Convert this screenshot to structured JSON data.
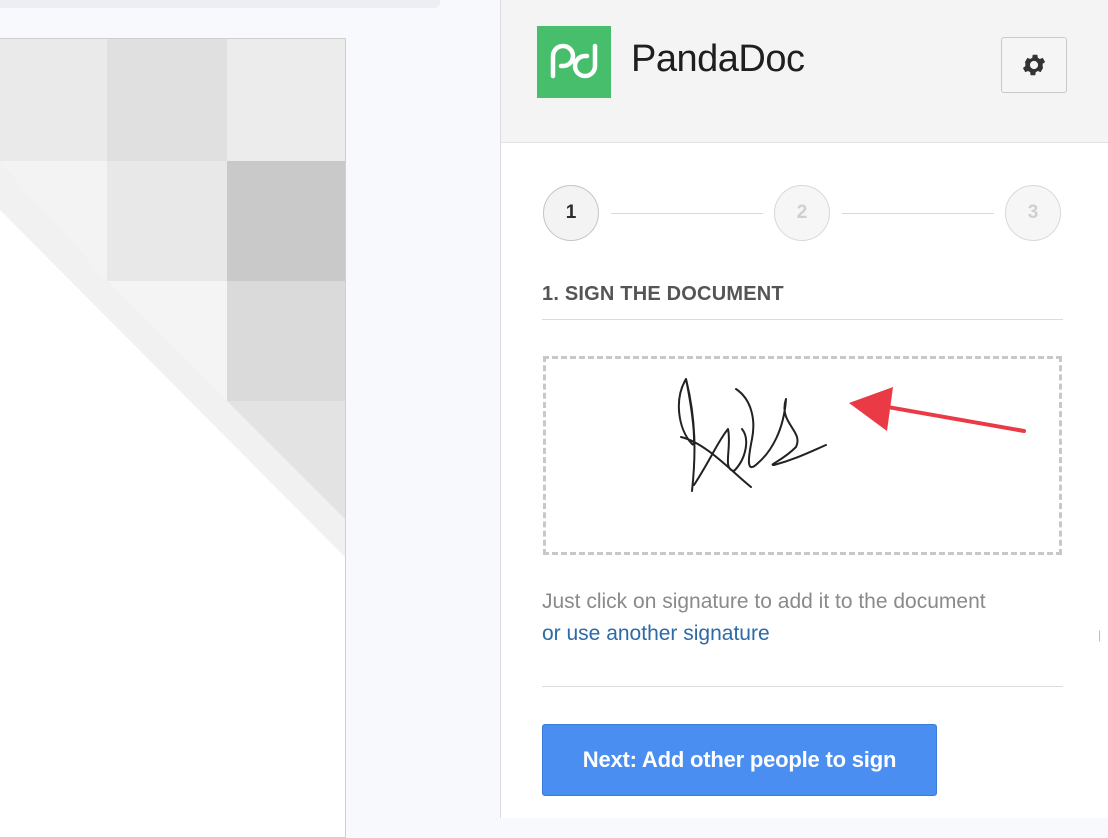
{
  "brand": {
    "name": "PandaDoc",
    "logo_icon": "pandadoc-logo-icon",
    "logo_color": "#47be6b"
  },
  "header": {
    "settings_icon": "gear-icon"
  },
  "stepper": {
    "steps": [
      "1",
      "2",
      "3"
    ],
    "active_step": "1"
  },
  "section": {
    "title": "1. SIGN THE DOCUMENT"
  },
  "signature": {
    "description_icon": "handwritten-signature",
    "annotation": "red-arrow-icon"
  },
  "hint": {
    "text": "Just click on signature to add it to the document",
    "link": "or use another signature"
  },
  "actions": {
    "next_label": "Next: Add other people to sign",
    "next_color": "#4a8ef1"
  },
  "colors": {
    "link": "#2d6aa6",
    "arrow": "#ea3a45"
  }
}
